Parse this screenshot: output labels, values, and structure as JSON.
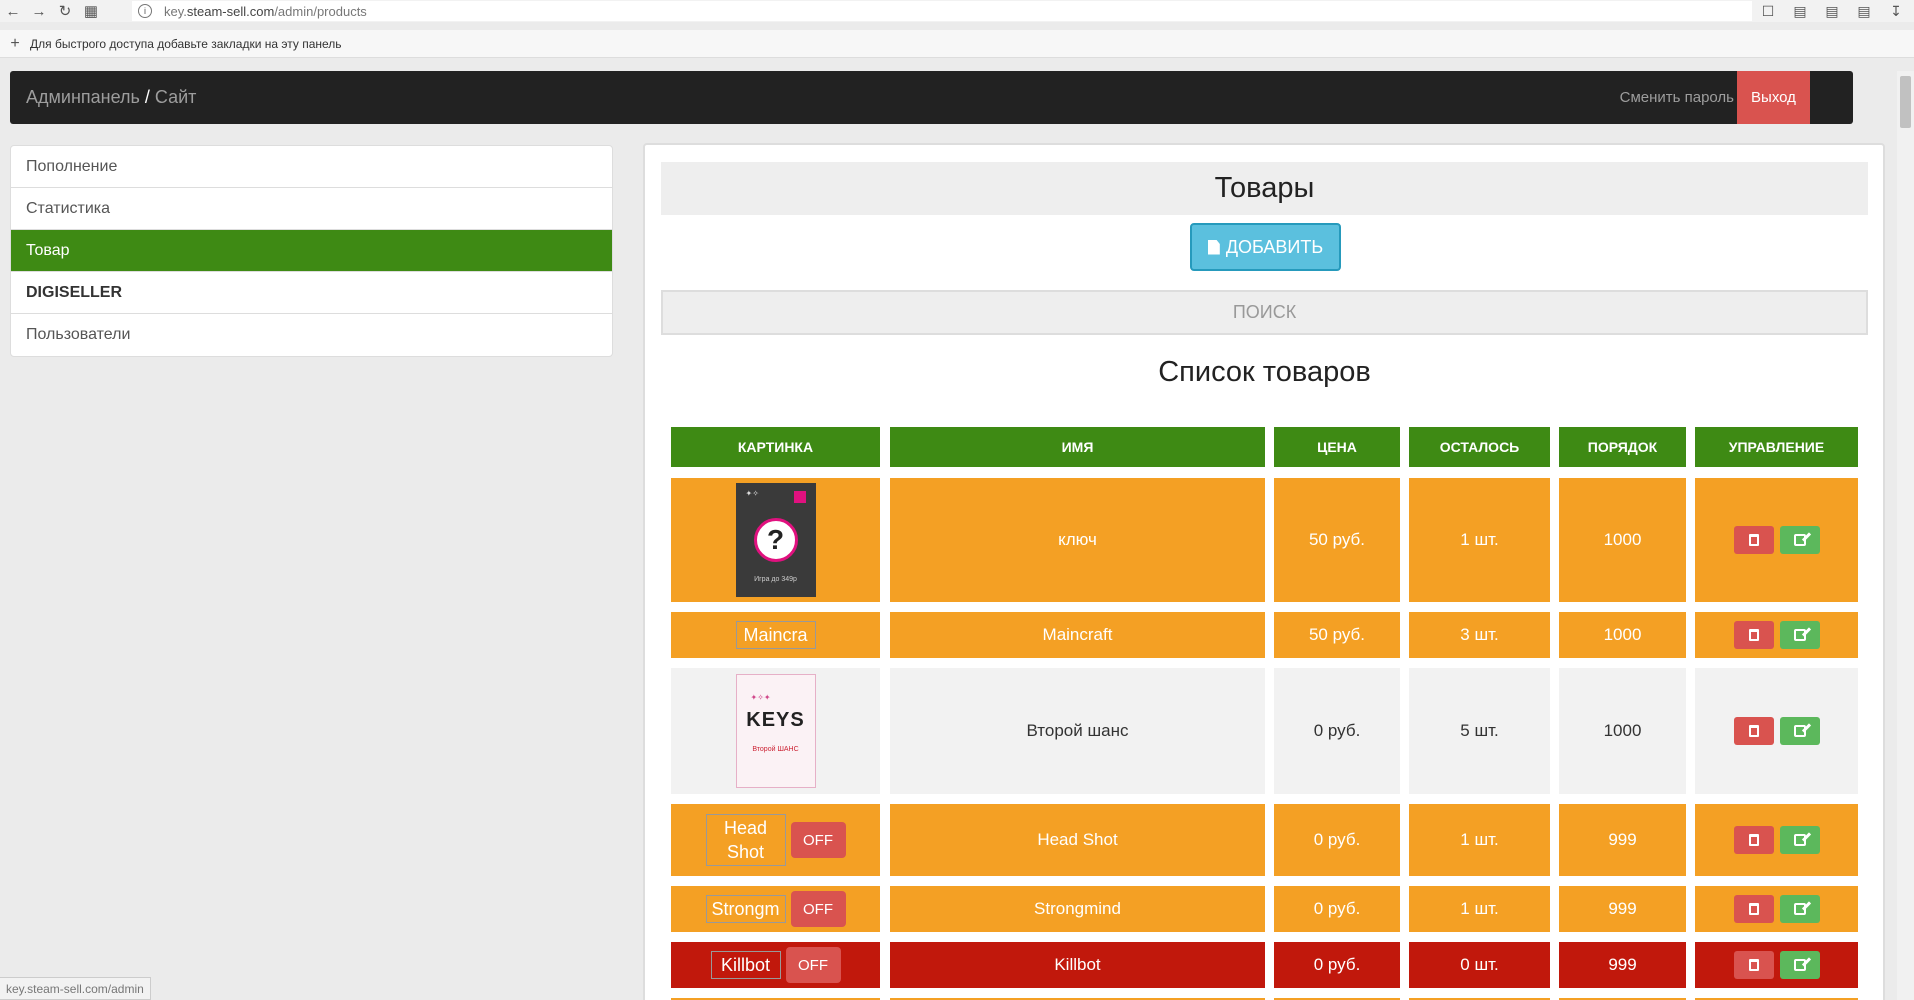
{
  "browser": {
    "url_prefix": "key.",
    "url_host": "steam-sell.com",
    "url_path": "/admin/products",
    "bookmark_hint": "Для быстрого доступа добавьте закладки на эту панель",
    "status_url": "key.steam-sell.com/admin"
  },
  "navbar": {
    "brand_admin": "Админпанель",
    "brand_sep": "/",
    "brand_site": "Сайт",
    "change_password": "Сменить пароль",
    "exit": "Выход"
  },
  "sidebar": {
    "items": [
      {
        "label": "Пополнение"
      },
      {
        "label": "Статистика"
      },
      {
        "label": "Товар"
      },
      {
        "label": "DIGISELLER"
      },
      {
        "label": "Пользователи"
      }
    ]
  },
  "main": {
    "title": "Товары",
    "add_button": "ДОБАВИТЬ",
    "search": "ПОИСК",
    "list_title": "Список товаров"
  },
  "table": {
    "headers": [
      "КАРТИНКА",
      "ИМЯ",
      "ЦЕНА",
      "ОСТАЛОСЬ",
      "ПОРЯДОК",
      "УПРАВЛЕНИЕ"
    ],
    "rows": [
      {
        "name": "ключ",
        "price": "50 руб.",
        "left": "1 шт.",
        "order": "1000",
        "image": "poster-question",
        "image_caption": "Игра до 349р",
        "off": ""
      },
      {
        "name": "Maincraft",
        "price": "50 руб.",
        "left": "3 шт.",
        "order": "1000",
        "image": "broken",
        "image_alt": "Maincra",
        "off": ""
      },
      {
        "name": "Второй шанс",
        "price": "0 руб.",
        "left": "5 шт.",
        "order": "1000",
        "image": "keys",
        "image_title": "KEYS",
        "image_sub": "Второй ШАНС",
        "off": ""
      },
      {
        "name": "Head Shot",
        "price": "0 руб.",
        "left": "1 шт.",
        "order": "999",
        "image": "broken",
        "image_alt": "Head Shot",
        "off": "OFF"
      },
      {
        "name": "Strongmind",
        "price": "0 руб.",
        "left": "1 шт.",
        "order": "999",
        "image": "broken",
        "image_alt": "Strongm",
        "off": "OFF"
      },
      {
        "name": "Killbot",
        "price": "0 руб.",
        "left": "0 шт.",
        "order": "999",
        "image": "broken",
        "image_alt": "Killbot",
        "off": "OFF"
      }
    ]
  },
  "colors": {
    "header_green": "#3e8a14",
    "row_orange": "#f4a024",
    "row_grey": "#f2f2f2",
    "row_red": "#c1180c",
    "danger": "#d9534f",
    "success": "#5cb85c",
    "info": "#5bc0de"
  }
}
